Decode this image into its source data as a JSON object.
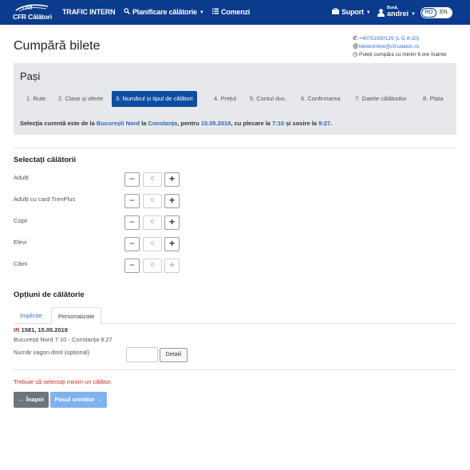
{
  "nav": {
    "logo_small": "CFR",
    "logo_text": "CFR Călători",
    "trafic": "TRAFIC INTERN",
    "planificare": "Planificare călătorie",
    "comenzi": "Comenzi",
    "suport": "Suport",
    "greeting": "Bună,",
    "user": "andrei",
    "lang_ro": "RO",
    "lang_en": "EN"
  },
  "header": {
    "title": "Cumpără bilete",
    "phone": "+40751990129 (L-D 8-20)",
    "email": "bileteonline@cfrcalatori.ro",
    "note": "Puteți cumpăra cu minim 6 ore înainte"
  },
  "steps": {
    "title": "Pași",
    "items": [
      "1. Rute",
      "2. Clase și oferte",
      "3. Numărul și tipul de călători",
      "4. Prețul",
      "5. Contul dvs.",
      "6. Confirmarea",
      "7. Datele călătorilor",
      "8. Plata"
    ],
    "active_index": 2,
    "selection": {
      "prefix": "Selecția curentă este de la",
      "from": "București Nord",
      "la": "la",
      "to": "Constanța",
      "pentru": ", pentru",
      "date": "15.05.2019",
      "plecare": ", cu plecare la",
      "dep": "7:10",
      "sosire": "și sosire la",
      "arr": "9:27",
      "end": "."
    }
  },
  "travelers": {
    "title": "Selectați călătorii",
    "rows": [
      {
        "label": "Adulți",
        "value": "0"
      },
      {
        "label": "Adulți cu card TrenPlus",
        "value": "0"
      },
      {
        "label": "Copii",
        "value": "0"
      },
      {
        "label": "Elevi",
        "value": "0"
      },
      {
        "label": "Câini",
        "value": "0"
      }
    ],
    "minus": "−",
    "plus": "+"
  },
  "options": {
    "title": "Opțiuni de călătorie",
    "tab_implicite": "Implicite",
    "tab_personalizate": "Personalizate",
    "train_type": "IR",
    "train_info": "1581, 15.05.2019",
    "route": "București Nord 7:10 - Constanța 9:27",
    "wagon_label": "Număr vagon dorit (opțional)",
    "wagon_value": "",
    "details_button": "Detalii"
  },
  "footer": {
    "error": "Trebuie să selectați minim un călător.",
    "back": "← Înapoi",
    "next": "Pasul următor →"
  }
}
